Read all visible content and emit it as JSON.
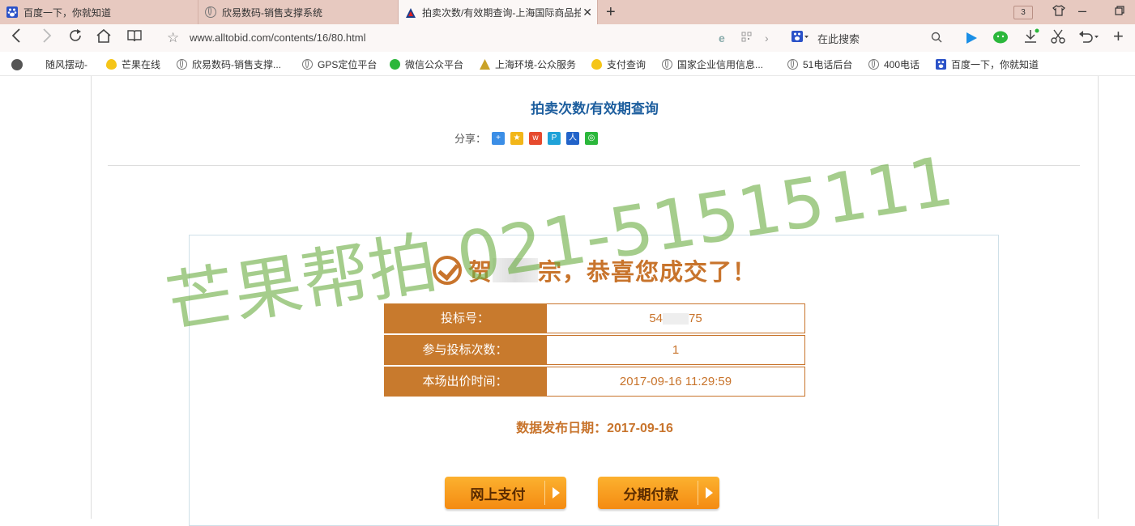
{
  "tabs": [
    {
      "label": "百度一下，你就知道",
      "icon": "baidu-paw-icon",
      "active": false
    },
    {
      "label": "欣易数码-销售支撑系统",
      "icon": "globe-icon",
      "active": false
    },
    {
      "label": "拍卖次数/有效期查询-上海国际商品拍",
      "icon": "alltobid-logo-icon",
      "active": true
    }
  ],
  "tab_count": "3",
  "address": {
    "url": "www.alltobid.com/contents/16/80.html",
    "search_placeholder": "在此搜索"
  },
  "bookmarks": [
    {
      "label": "随风摆动-",
      "icon": "avatar-icon"
    },
    {
      "label": "芒果在线",
      "icon": "mango-icon"
    },
    {
      "label": "欣易数码-销售支撑...",
      "icon": "globe-icon"
    },
    {
      "label": "GPS定位平台",
      "icon": "globe-icon"
    },
    {
      "label": "微信公众平台",
      "icon": "wechat-icon"
    },
    {
      "label": "上海环境-公众服务",
      "icon": "shanghai-env-icon"
    },
    {
      "label": "支付查询",
      "icon": "mango-icon"
    },
    {
      "label": "国家企业信用信息...",
      "icon": "globe-icon"
    },
    {
      "label": "51电话后台",
      "icon": "globe-icon"
    },
    {
      "label": "400电话",
      "icon": "globe-icon"
    },
    {
      "label": "百度一下，你就知道",
      "icon": "baidu-paw-icon"
    }
  ],
  "page": {
    "title": "拍卖次数/有效期查询",
    "share_label": "分享：",
    "congrats_prefix": "贺",
    "congrats_suffix": "宗，恭喜您成交了！",
    "rows": [
      {
        "label": "投标号：",
        "value_prefix": "54",
        "value_suffix": "75"
      },
      {
        "label": "参与投标次数：",
        "value": "1"
      },
      {
        "label": "本场出价时间：",
        "value": "2017-09-16 11:29:59"
      }
    ],
    "publish_date": "数据发布日期：2017-09-16",
    "buttons": {
      "online_pay": "网上支付",
      "installment": "分期付款"
    }
  },
  "watermark": "芒果帮拍 021-51515111",
  "colors": {
    "accent": "#c8742c",
    "title_blue": "#1d5e9e",
    "tabbar": "#e7c9c0",
    "watermark": "#6eaf46"
  }
}
